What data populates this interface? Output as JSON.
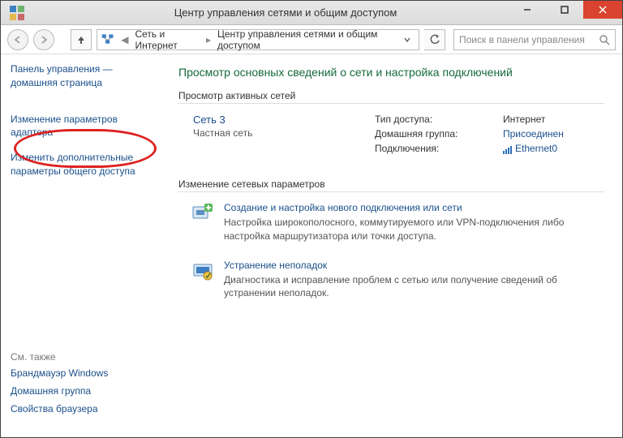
{
  "window": {
    "title": "Центр управления сетями и общим доступом"
  },
  "breadcrumb": {
    "root": "Сеть и Интернет",
    "current": "Центр управления сетями и общим доступом"
  },
  "search": {
    "placeholder": "Поиск в панели управления"
  },
  "sidebar": {
    "home": "Панель управления — домашняя страница",
    "adapter": "Изменение параметров адаптера",
    "sharing": "Изменить дополнительные параметры общего доступа",
    "see_also": "См. также",
    "firewall": "Брандмауэр Windows",
    "homegroup": "Домашняя группа",
    "inet": "Свойства браузера"
  },
  "main": {
    "heading": "Просмотр основных сведений о сети и настройка подключений",
    "active_title": "Просмотр активных сетей",
    "net_name": "Сеть 3",
    "net_type": "Частная сеть",
    "access_k": "Тип доступа:",
    "access_v": "Интернет",
    "hg_k": "Домашняя группа:",
    "hg_v": "Присоединен",
    "conn_k": "Подключения:",
    "conn_v": "Ethernet0",
    "change_title": "Изменение сетевых параметров",
    "new_conn_t": "Создание и настройка нового подключения или сети",
    "new_conn_d": "Настройка широкополосного, коммутируемого или VPN-подключения либо настройка маршрутизатора или точки доступа.",
    "troub_t": "Устранение неполадок",
    "troub_d": "Диагностика и исправление проблем с сетью или получение сведений об устранении неполадок."
  }
}
